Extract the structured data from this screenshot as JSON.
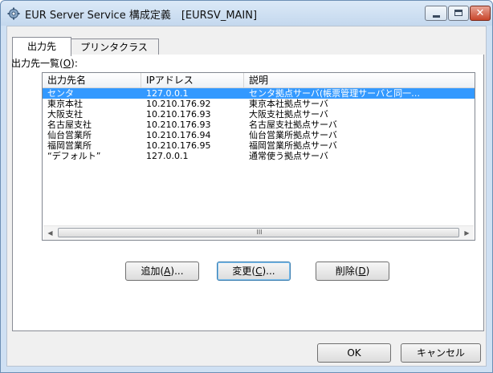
{
  "window": {
    "title": "EUR Server Service 構成定義　[EURSV_MAIN]",
    "controls": {
      "minimize": "−",
      "maximize": "□",
      "close": "✕"
    }
  },
  "tabs": [
    {
      "label": "出力先"
    },
    {
      "label": "プリンタクラス"
    }
  ],
  "list": {
    "label": "出力先一覧(O):",
    "columns": [
      "出力先名",
      "IPアドレス",
      "説明"
    ],
    "rows": [
      {
        "name": "センタ",
        "ip": "127.0.0.1",
        "desc": "センタ拠点サーバ(帳票管理サーバと同一…",
        "selected": true
      },
      {
        "name": "東京本社",
        "ip": "10.210.176.92",
        "desc": "東京本社拠点サーバ",
        "selected": false
      },
      {
        "name": "大阪支社",
        "ip": "10.210.176.93",
        "desc": "大阪支社拠点サーバ",
        "selected": false
      },
      {
        "name": "名古屋支社",
        "ip": "10.210.176.93",
        "desc": "名古屋支社拠点サーバ",
        "selected": false
      },
      {
        "name": "仙台営業所",
        "ip": "10.210.176.94",
        "desc": "仙台営業所拠点サーバ",
        "selected": false
      },
      {
        "name": "福岡営業所",
        "ip": "10.210.176.95",
        "desc": "福岡営業所拠点サーバ",
        "selected": false
      },
      {
        "name": "“デフォルト”",
        "ip": "127.0.0.1",
        "desc": "通常使う拠点サーバ",
        "selected": false
      }
    ],
    "scrollbar": {
      "left": "◀",
      "right": "▶",
      "grip": "III"
    }
  },
  "buttons": {
    "add": "追加(A)...",
    "change": "変更(C)...",
    "delete": "削除(D)",
    "ok": "OK",
    "cancel": "キャンセル"
  },
  "colors": {
    "selection": "#3399ff",
    "titlebar": "#c4d8ee",
    "close": "#c8452a"
  }
}
